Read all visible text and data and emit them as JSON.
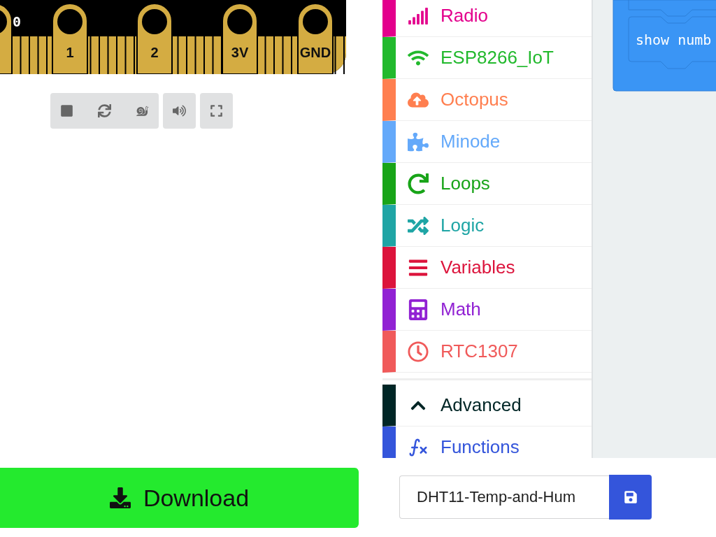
{
  "simulator": {
    "pins": [
      {
        "label": "0"
      },
      {
        "label": "1"
      },
      {
        "label": "2"
      },
      {
        "label": "3V"
      },
      {
        "label": "GND"
      }
    ]
  },
  "download": {
    "label": "Download"
  },
  "toolbox": {
    "categories": [
      {
        "label": "Radio",
        "color": "#e3008c"
      },
      {
        "label": "ESP8266_IoT",
        "color": "#22b92d"
      },
      {
        "label": "Octopus",
        "color": "#ff7f50"
      },
      {
        "label": "Minode",
        "color": "#64a9fa"
      },
      {
        "label": "Loops",
        "color": "#18a418"
      },
      {
        "label": "Logic",
        "color": "#1fa5a5"
      },
      {
        "label": "Variables",
        "color": "#dc143c"
      },
      {
        "label": "Math",
        "color": "#9122d3"
      },
      {
        "label": "RTC1307",
        "color": "#f05a5a"
      }
    ],
    "advanced": {
      "label": "Advanced",
      "expanded": true,
      "color": "#002626"
    },
    "advanced_categories": [
      {
        "label": "Functions",
        "color": "#3455db"
      }
    ]
  },
  "workspace": {
    "block_text": "show numb"
  },
  "project": {
    "name": "DHT11-Temp-and-Hum"
  }
}
